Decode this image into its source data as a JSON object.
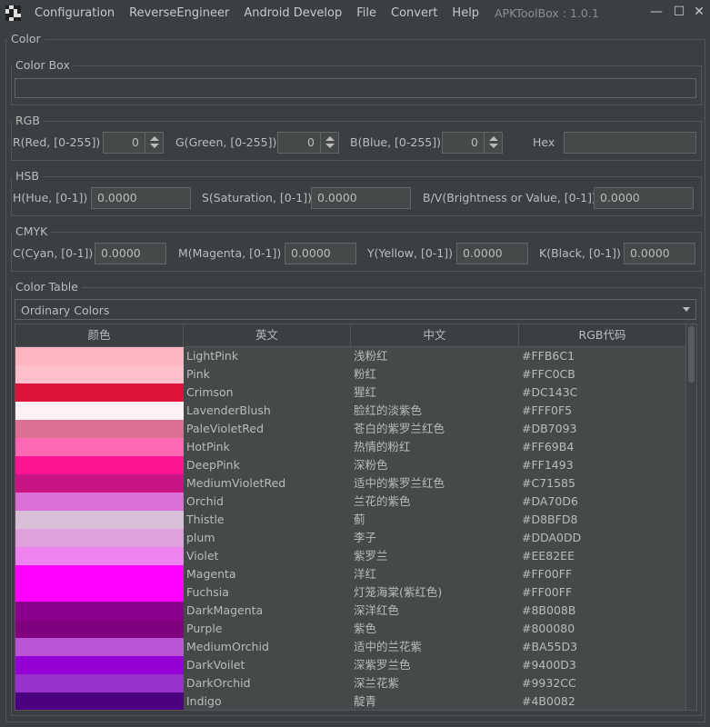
{
  "menu": [
    "Configuration",
    "ReverseEngineer",
    "Android Develop",
    "File",
    "Convert",
    "Help"
  ],
  "app_title": "APKToolBox : 1.0.1",
  "window_buttons": {
    "min": "—",
    "max": "☐",
    "close": "✕"
  },
  "panel_title": "Color",
  "color_box": {
    "legend": "Color Box"
  },
  "rgb": {
    "legend": "RGB",
    "red_label": "R(Red, [0-255])",
    "red_value": "0",
    "green_label": "G(Green, [0-255])",
    "green_value": "0",
    "blue_label": "B(Blue, [0-255])",
    "blue_value": "0",
    "hex_label": "Hex",
    "hex_value": ""
  },
  "hsb": {
    "legend": "HSB",
    "h_label": "H(Hue, [0-1])",
    "h_value": "0.0000",
    "s_label": "S(Saturation, [0-1])",
    "s_value": "0.0000",
    "b_label": "B/V(Brightness or Value, [0-1])",
    "b_value": "0.0000"
  },
  "cmyk": {
    "legend": "CMYK",
    "c_label": "C(Cyan, [0-1])",
    "c_value": "0.0000",
    "m_label": "M(Magenta, [0-1])",
    "m_value": "0.0000",
    "y_label": "Y(Yellow, [0-1])",
    "y_value": "0.0000",
    "k_label": "K(Black, [0-1])",
    "k_value": "0.0000"
  },
  "color_table": {
    "legend": "Color Table",
    "selected": "Ordinary Colors",
    "columns": [
      "颜色",
      "英文",
      "中文",
      "RGB代码"
    ],
    "rows": [
      {
        "en": "LightPink",
        "zh": "浅粉红",
        "hex": "#FFB6C1"
      },
      {
        "en": "Pink",
        "zh": "粉红",
        "hex": "#FFC0CB"
      },
      {
        "en": "Crimson",
        "zh": "猩红",
        "hex": "#DC143C"
      },
      {
        "en": "LavenderBlush",
        "zh": "脸红的淡紫色",
        "hex": "#FFF0F5"
      },
      {
        "en": "PaleVioletRed",
        "zh": "苍白的紫罗兰红色",
        "hex": "#DB7093"
      },
      {
        "en": "HotPink",
        "zh": "热情的粉红",
        "hex": "#FF69B4"
      },
      {
        "en": "DeepPink",
        "zh": "深粉色",
        "hex": "#FF1493"
      },
      {
        "en": "MediumVioletRed",
        "zh": "适中的紫罗兰红色",
        "hex": "#C71585"
      },
      {
        "en": "Orchid",
        "zh": "兰花的紫色",
        "hex": "#DA70D6"
      },
      {
        "en": "Thistle",
        "zh": "蓟",
        "hex": "#D8BFD8"
      },
      {
        "en": "plum",
        "zh": "李子",
        "hex": "#DDA0DD"
      },
      {
        "en": "Violet",
        "zh": "紫罗兰",
        "hex": "#EE82EE"
      },
      {
        "en": "Magenta",
        "zh": "洋红",
        "hex": "#FF00FF"
      },
      {
        "en": "Fuchsia",
        "zh": "灯笼海棠(紫红色)",
        "hex": "#FF00FF"
      },
      {
        "en": "DarkMagenta",
        "zh": "深洋红色",
        "hex": "#8B008B"
      },
      {
        "en": "Purple",
        "zh": "紫色",
        "hex": "#800080"
      },
      {
        "en": "MediumOrchid",
        "zh": "适中的兰花紫",
        "hex": "#BA55D3"
      },
      {
        "en": "DarkVoilet",
        "zh": "深紫罗兰色",
        "hex": "#9400D3"
      },
      {
        "en": "DarkOrchid",
        "zh": "深兰花紫",
        "hex": "#9932CC"
      },
      {
        "en": "Indigo",
        "zh": "靛青",
        "hex": "#4B0082"
      }
    ]
  }
}
